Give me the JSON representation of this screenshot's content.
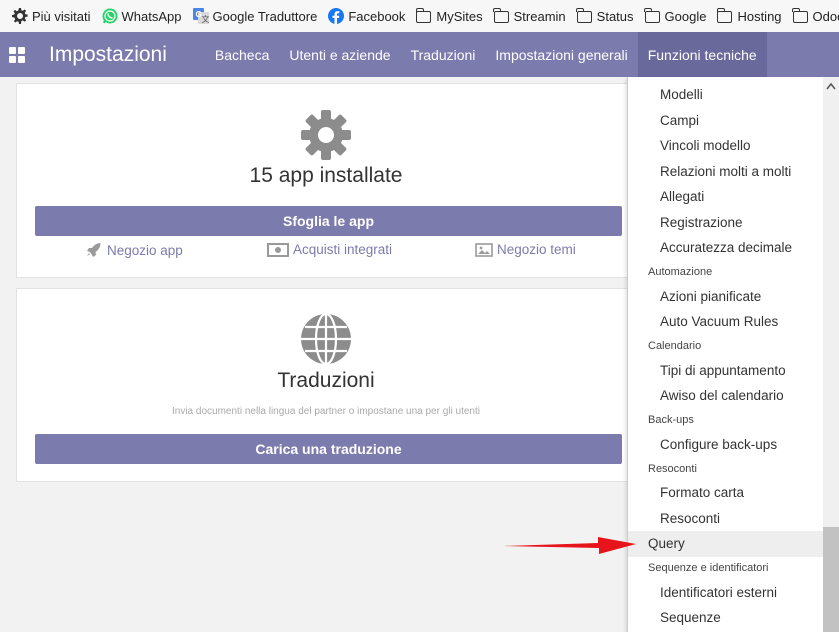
{
  "bookmarks": [
    {
      "label": "Più visitati",
      "icon": "gear-icon"
    },
    {
      "label": "WhatsApp",
      "icon": "whatsapp-icon"
    },
    {
      "label": "Google Traduttore",
      "icon": "google-translate-icon"
    },
    {
      "label": "Facebook",
      "icon": "facebook-icon"
    },
    {
      "label": "MySites",
      "icon": "folder-icon"
    },
    {
      "label": "Streamin",
      "icon": "folder-icon"
    },
    {
      "label": "Status",
      "icon": "folder-icon"
    },
    {
      "label": "Google",
      "icon": "folder-icon"
    },
    {
      "label": "Hosting",
      "icon": "folder-icon"
    },
    {
      "label": "Odoo",
      "icon": "folder-icon"
    }
  ],
  "navbar": {
    "brand": "Impostazioni",
    "menu": [
      "Bacheca",
      "Utenti e aziende",
      "Traduzioni",
      "Impostazioni generali",
      "Funzioni tecniche"
    ],
    "active": "Funzioni tecniche",
    "color": "#7c7bad"
  },
  "apps_card": {
    "title": "15 app installate",
    "button": "Sfoglia le app",
    "links": [
      "Negozio app",
      "Acquisti integrati",
      "Negozio temi"
    ]
  },
  "translations_card": {
    "title": "Traduzioni",
    "subtitle": "Invia documenti nella lingua del partner o impostane una per gli utenti",
    "button": "Carica una traduzione"
  },
  "dropdown": {
    "items": [
      {
        "type": "item",
        "label": "Modelli"
      },
      {
        "type": "item",
        "label": "Campi"
      },
      {
        "type": "item",
        "label": "Vincoli modello"
      },
      {
        "type": "item",
        "label": "Relazioni molti a molti"
      },
      {
        "type": "item",
        "label": "Allegati"
      },
      {
        "type": "item",
        "label": "Registrazione"
      },
      {
        "type": "item",
        "label": "Accuratezza decimale"
      },
      {
        "type": "header",
        "label": "Automazione"
      },
      {
        "type": "item",
        "label": "Azioni pianificate"
      },
      {
        "type": "item",
        "label": "Auto Vacuum Rules"
      },
      {
        "type": "header",
        "label": "Calendario"
      },
      {
        "type": "item",
        "label": "Tipi di appuntamento"
      },
      {
        "type": "item",
        "label": "Awiso del calendario"
      },
      {
        "type": "header",
        "label": "Back-ups"
      },
      {
        "type": "item",
        "label": "Configure back-ups"
      },
      {
        "type": "header",
        "label": "Resoconti"
      },
      {
        "type": "item",
        "label": "Formato carta"
      },
      {
        "type": "item",
        "label": "Resoconti"
      },
      {
        "type": "top",
        "label": "Query",
        "highlighted": true
      },
      {
        "type": "header",
        "label": "Sequenze e identificatori"
      },
      {
        "type": "item",
        "label": "Identificatori esterni"
      },
      {
        "type": "item",
        "label": "Sequenze"
      }
    ]
  }
}
